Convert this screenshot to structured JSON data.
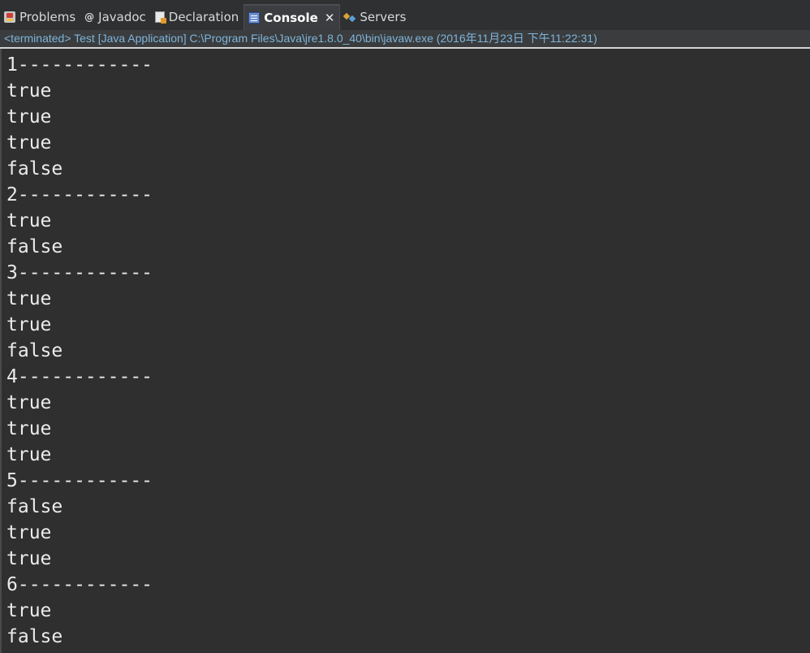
{
  "tabs": [
    {
      "label": "Problems",
      "icon": "problems-icon",
      "active": false
    },
    {
      "label": "Javadoc",
      "icon": "javadoc-icon",
      "active": false
    },
    {
      "label": "Declaration",
      "icon": "declaration-icon",
      "active": false
    },
    {
      "label": "Console",
      "icon": "console-icon",
      "active": true
    },
    {
      "label": "Servers",
      "icon": "servers-icon",
      "active": false
    }
  ],
  "console": {
    "status": "<terminated> Test [Java Application] C:\\Program Files\\Java\\jre1.8.0_40\\bin\\javaw.exe (2016年11月23日 下午11:22:31)",
    "close_symbol": "✕",
    "javadoc_glyph": "@",
    "lines": [
      "1------------",
      "true",
      "true",
      "true",
      "false",
      "2------------",
      "true",
      "false",
      "3------------",
      "true",
      "true",
      "false",
      "4------------",
      "true",
      "true",
      "true",
      "5------------",
      "false",
      "true",
      "true",
      "6------------",
      "true",
      "false"
    ]
  },
  "colors": {
    "background": "#2f2f2f",
    "text": "#ebebeb",
    "status_text": "#7fb4d9"
  }
}
